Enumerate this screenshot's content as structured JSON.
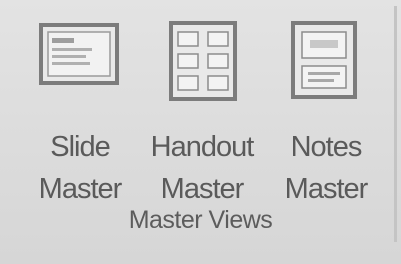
{
  "group": {
    "label": "Master Views"
  },
  "commands": [
    {
      "name": "slide-master",
      "line1": "Slide",
      "line2": "Master",
      "icon": "slide-master-icon"
    },
    {
      "name": "handout-master",
      "line1": "Handout",
      "line2": "Master",
      "icon": "handout-master-icon"
    },
    {
      "name": "notes-master",
      "line1": "Notes",
      "line2": "Master",
      "icon": "notes-master-icon"
    }
  ],
  "colors": {
    "background": "#dadada",
    "icon_stroke": "#7a7a7a",
    "text": "#5a5a5a"
  }
}
